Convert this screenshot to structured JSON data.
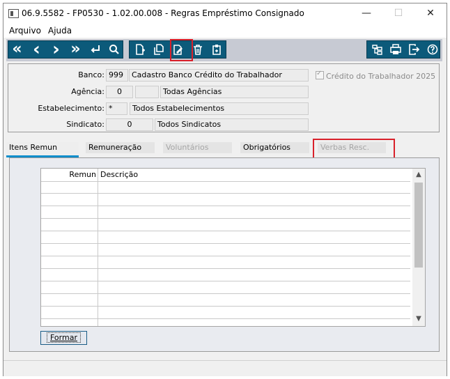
{
  "window": {
    "title": "06.9.5582 - FP0530 - 1.02.00.008 - Regras Empréstimo Consignado",
    "minimize_glyph": "—",
    "maximize_glyph": "☐",
    "close_glyph": "✕"
  },
  "menu": {
    "items": [
      "Arquivo",
      "Ajuda"
    ]
  },
  "toolbar": {
    "nav": {
      "first": "«",
      "prev": "‹",
      "next": "›",
      "last": "»",
      "enter_icon": "return-icon",
      "search_icon": "search-icon"
    },
    "actions": [
      "new-document-icon",
      "copy-document-icon",
      "edit-document-icon",
      "delete-icon",
      "clipboard-icon"
    ],
    "right": [
      "tree-structure-icon",
      "print-icon",
      "exit-icon",
      "help-icon"
    ],
    "highlight_color": "#d9202a",
    "bg_color": "#0c5a7a"
  },
  "form": {
    "banco": {
      "label": "Banco:",
      "code": "999",
      "desc": "Cadastro Banco Crédito do Trabalhador"
    },
    "agencia": {
      "label": "Agência:",
      "code": "0",
      "digit": "",
      "desc": "Todas Agências"
    },
    "estabelecimento": {
      "label": "Estabelecimento:",
      "code": "*",
      "desc": "Todos Estabelecimentos"
    },
    "sindicato": {
      "label": "Sindicato:",
      "code": "0",
      "desc": "Todos Sindicatos"
    },
    "credito_checkbox": {
      "label": "Crédito do Trabalhador 2025",
      "checked": true
    }
  },
  "tabs": [
    {
      "label": "Itens Remun",
      "state": "active"
    },
    {
      "label": "Remuneração",
      "state": "normal"
    },
    {
      "label": "Voluntários",
      "state": "disabled"
    },
    {
      "label": "Obrigatórios",
      "state": "normal"
    },
    {
      "label": "Verbas Resc.",
      "state": "disabled-highlighted"
    }
  ],
  "grid": {
    "columns": [
      "Remun",
      "Descrição"
    ],
    "rows": []
  },
  "buttons": {
    "formar": "Formar"
  }
}
